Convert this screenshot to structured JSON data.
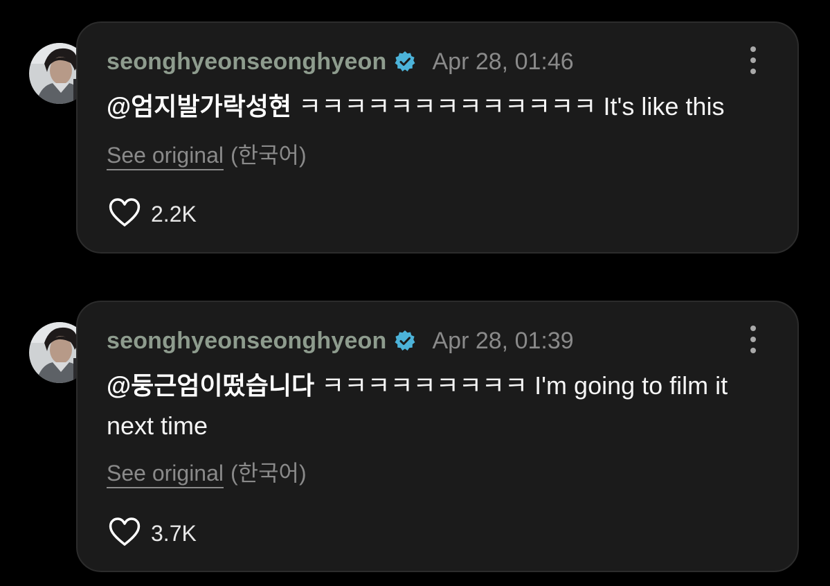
{
  "comments": [
    {
      "username": "seonghyeonseonghyeon",
      "verified_icon": "verified-badge-icon",
      "timestamp": "Apr 28, 01:46",
      "mention": "@엄지발가락성현",
      "text": "ㅋㅋㅋㅋㅋㅋㅋㅋㅋㅋㅋㅋㅋ It's like this",
      "see_original_label": "See original",
      "language_label": "(한국어)",
      "like_icon": "heart-icon",
      "like_count": "2.2K"
    },
    {
      "username": "seonghyeonseonghyeon",
      "verified_icon": "verified-badge-icon",
      "timestamp": "Apr 28, 01:39",
      "mention": "@둥근엄이떴습니다",
      "text": "ㅋㅋㅋㅋㅋㅋㅋㅋㅋ I'm going to film it next time",
      "see_original_label": "See original",
      "language_label": "(한국어)",
      "like_icon": "heart-icon",
      "like_count": "3.7K"
    }
  ],
  "colors": {
    "background": "#000000",
    "bubble": "#1b1b1b",
    "username": "#8e9c8e",
    "verified": "#4cb3d9",
    "muted": "#8a8a8a",
    "text": "#f5f5f5"
  }
}
